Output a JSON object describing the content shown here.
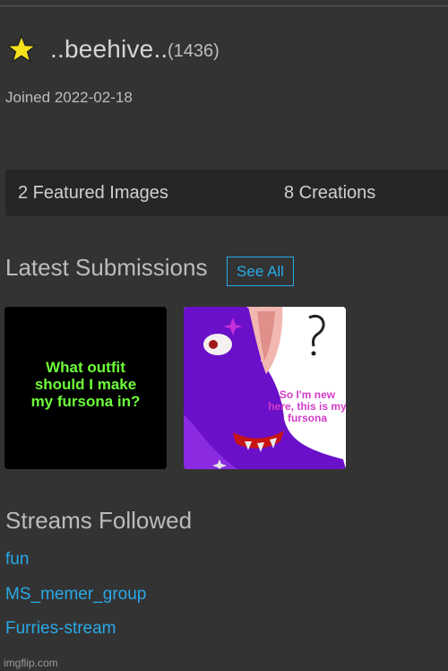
{
  "profile": {
    "username": "..beehive..",
    "points": "(1436)",
    "joined": "Joined 2022-02-18",
    "star_color": "#f5e21c"
  },
  "stats": {
    "featured": "2 Featured Images",
    "creations": "8 Creations"
  },
  "latest": {
    "title": "Latest Submissions",
    "see_all": "See All",
    "submissions": [
      {
        "caption": "What outfit should I make my fursona in?"
      },
      {
        "caption": "So I'm new here, this is my fursona"
      }
    ]
  },
  "streams": {
    "title": "Streams Followed",
    "items": [
      "fun",
      "MS_memer_group",
      "Furries-stream"
    ]
  },
  "footer": {
    "watermark": "imgflip.com"
  },
  "colors": {
    "link": "#29a9e6",
    "background": "#333333",
    "caption_green": "#6eff3a"
  }
}
